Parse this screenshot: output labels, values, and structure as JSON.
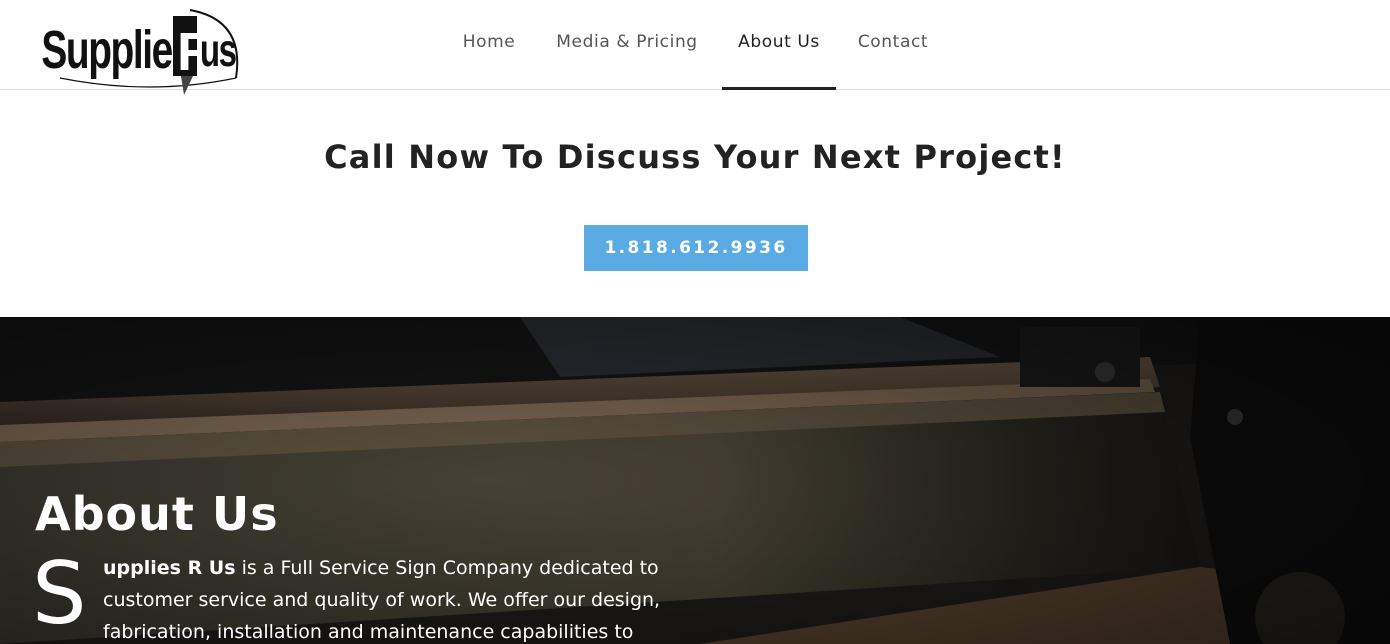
{
  "header": {
    "logo_text": "Supplies R Us",
    "nav": [
      {
        "label": "Home",
        "active": false
      },
      {
        "label": "Media & Pricing",
        "active": false
      },
      {
        "label": "About Us",
        "active": true
      },
      {
        "label": "Contact",
        "active": false
      }
    ]
  },
  "cta": {
    "title": "Call Now To Discuss Your Next Project!",
    "phone": "1.818.612.9936"
  },
  "about": {
    "title": "About Us",
    "dropcap": "S",
    "lead": "upplies R Us",
    "body": " is a Full Service Sign Company dedicated to customer service and quality of work. We offer our design, fabrication, installation and maintenance capabilities to"
  },
  "colors": {
    "accent": "#5aabe3",
    "text_dark": "#222222",
    "nav_text": "#555555",
    "hero_bg": "#1c1a18"
  }
}
